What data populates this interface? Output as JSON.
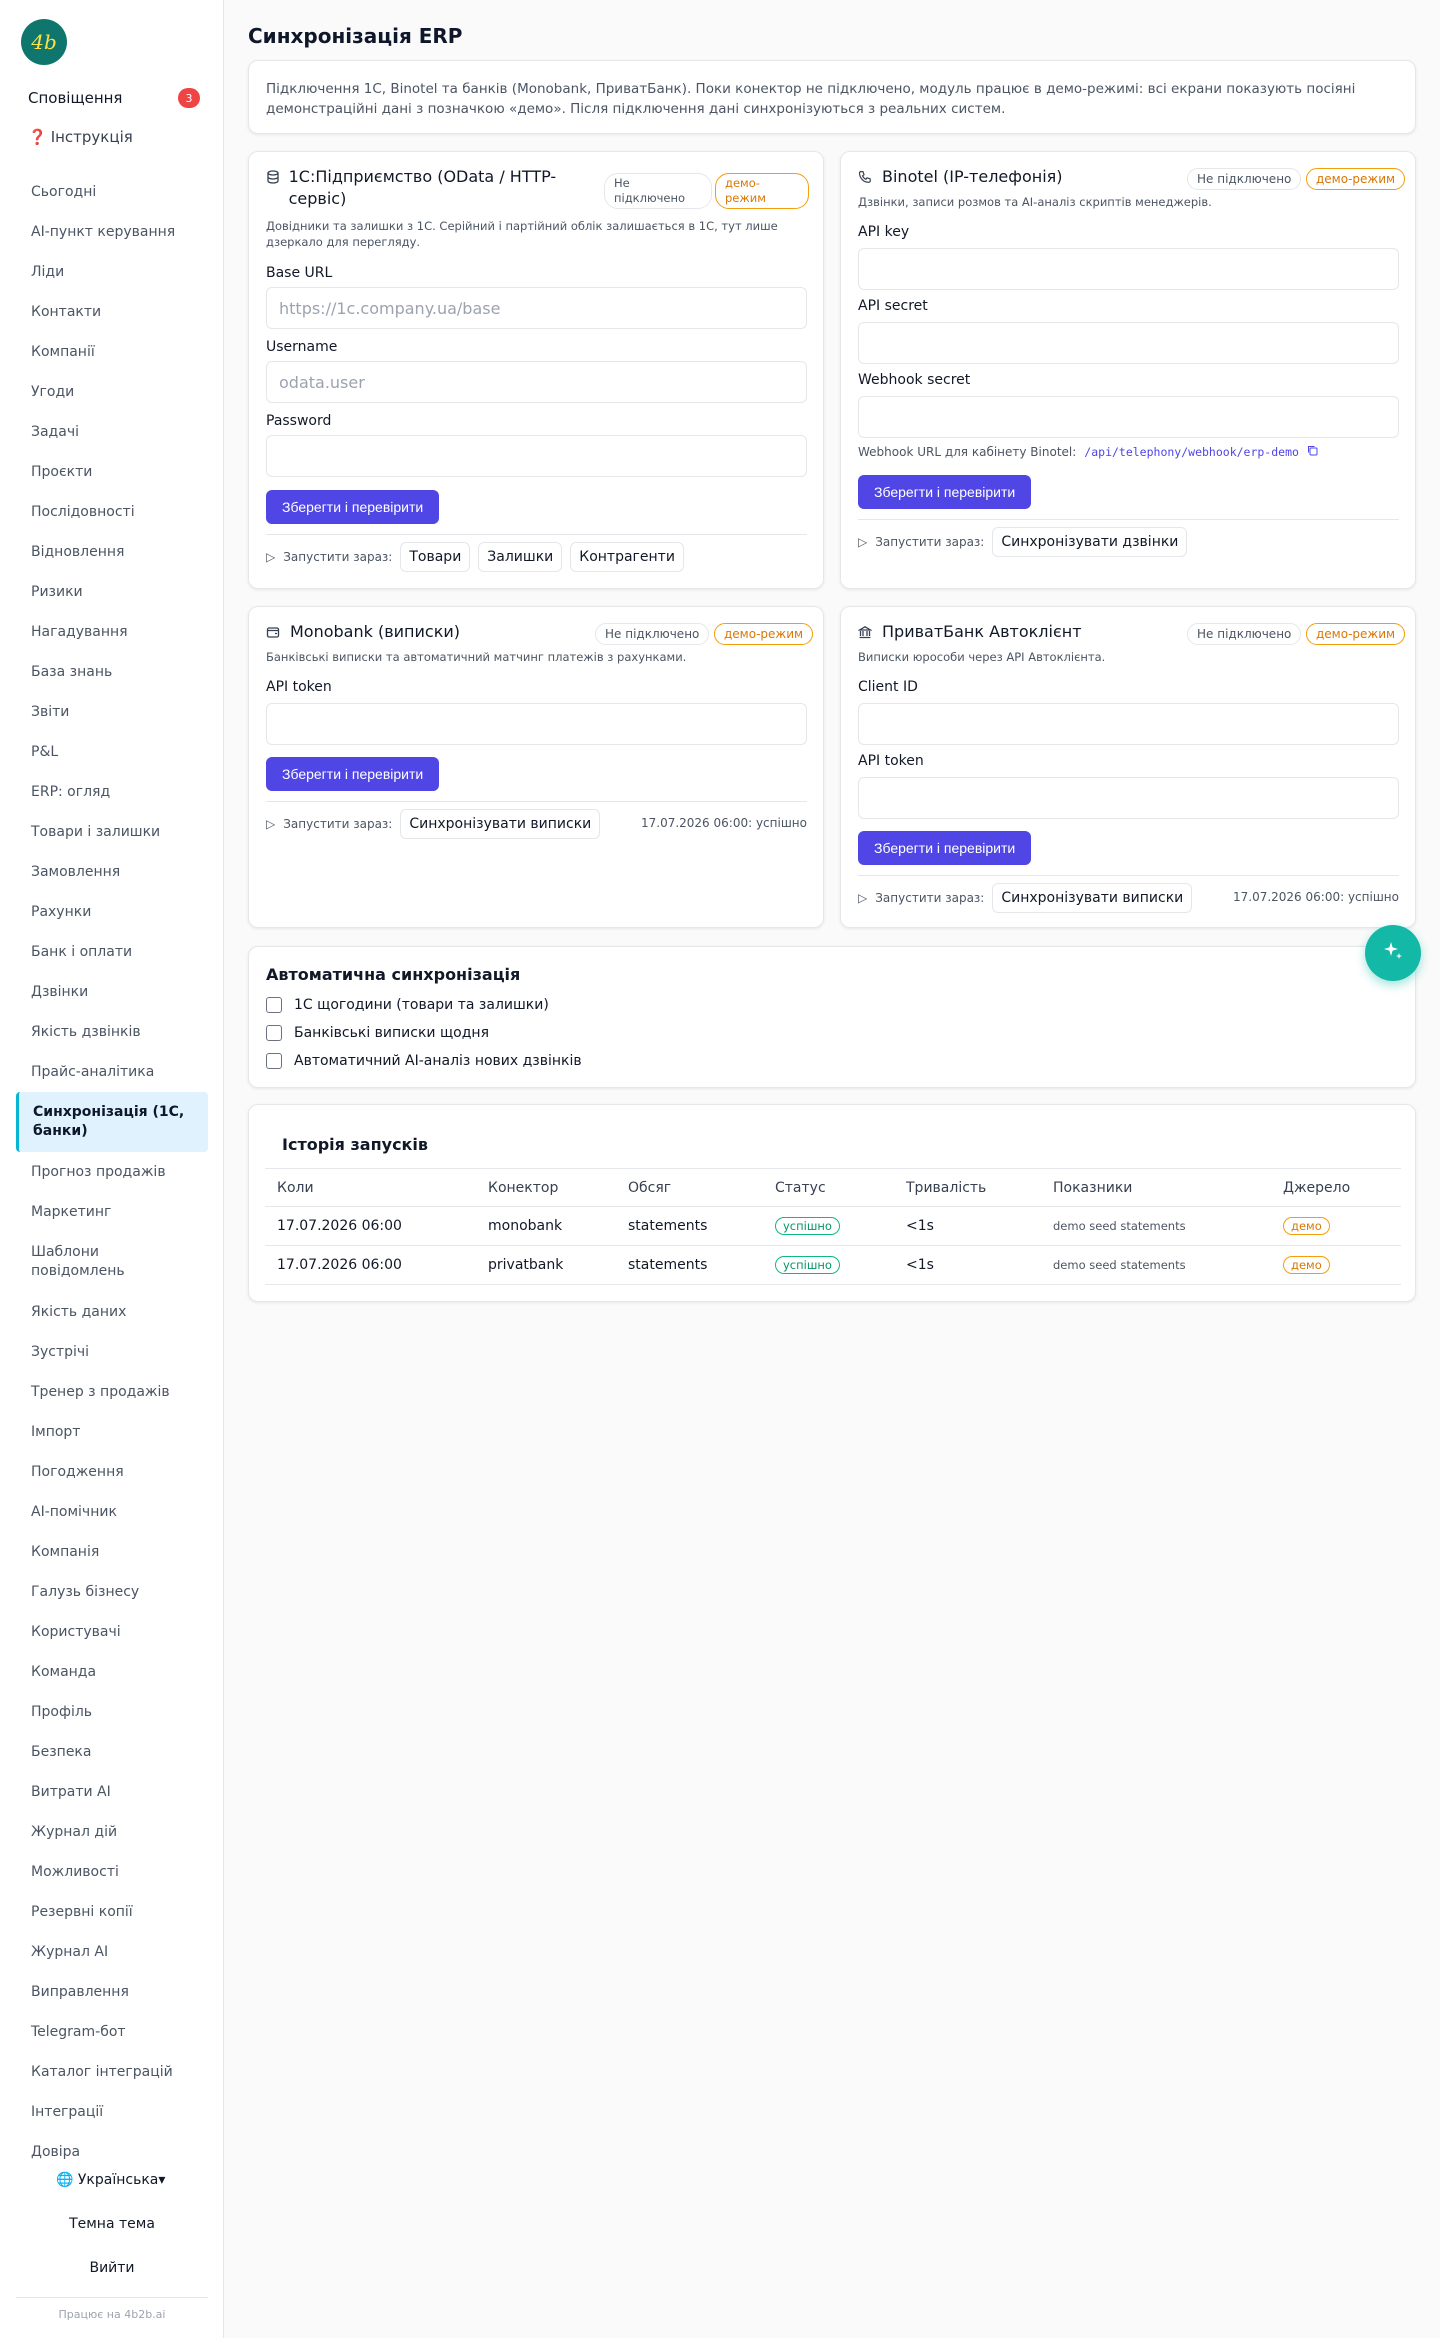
{
  "sidebar": {
    "logo_text": "4b",
    "notifications_label": "Сповіщення",
    "notifications_count": "3",
    "help_label": "Інструкція",
    "help_icon": "❓",
    "items": [
      "Сьогодні",
      "AI-пункт керування",
      "Ліди",
      "Контакти",
      "Компанії",
      "Угоди",
      "Задачі",
      "Проєкти",
      "Послідовності",
      "Відновлення",
      "Ризики",
      "Нагадування",
      "База знань",
      "Звіти",
      "P&L",
      "ERP: огляд",
      "Товари і залишки",
      "Замовлення",
      "Рахунки",
      "Банк і оплати",
      "Дзвінки",
      "Якість дзвінків",
      "Прайс-аналітика",
      "Синхронізація (1С, банки)",
      "Прогноз продажів",
      "Маркетинг",
      "Шаблони повідомлень",
      "Якість даних",
      "Зустрічі",
      "Тренер з продажів",
      "Імпорт",
      "Погодження",
      "AI-помічник",
      "Компанія",
      "Галузь бізнесу",
      "Користувачі",
      "Команда",
      "Профіль",
      "Безпека",
      "Витрати AI",
      "Журнал дій",
      "Можливості",
      "Резервні копії",
      "Журнал AI",
      "Виправлення",
      "Telegram-бот",
      "Каталог інтеграцій",
      "Інтеграції",
      "Довіра"
    ],
    "active_item": "Синхронізація (1С, банки)",
    "language": "🌐 Українська▾",
    "theme_label": "Темна тема",
    "logout_label": "Вийти",
    "powered_by": "Працює на 4b2b.ai"
  },
  "page": {
    "title": "Синхронізація ERP",
    "intro": "Підключення 1С, Binotel та банків (Monobank, ПриватБанк). Поки конектор не підключено, модуль працює в демо-режимі: всі екрани показують посіяні демонстраційні дані з позначкою «демо». Після підключення дані синхронізуються з реальних систем."
  },
  "status": {
    "not_connected": "Не підключено",
    "demo": "демо-режим",
    "not_connected_wrap": "Не\nпідключено",
    "demo_wrap": "демо-\nрежим"
  },
  "common": {
    "save_button": "Зберегти і перевірити",
    "run_now": "Запустити зараз:",
    "sync_calls": "Синхронізувати дзвінки",
    "sync_statements": "Синхронізувати виписки",
    "last_run": "17.07.2026 06:00: успішно"
  },
  "onec": {
    "title": "1С:Підприємство (OData / HTTP-сервіс)",
    "desc": "Довідники та залишки з 1С. Серійний і партійний облік залишається в 1С, тут лише дзеркало для перегляду.",
    "base_url_label": "Base URL",
    "base_url_placeholder": "https://1c.company.ua/base",
    "username_label": "Username",
    "username_placeholder": "odata.user",
    "password_label": "Password",
    "run_products": "Товари",
    "run_stock": "Залишки",
    "run_counterparties": "Контрагенти"
  },
  "binotel": {
    "title": "Binotel (IP-телефонія)",
    "desc": "Дзвінки, записи розмов та AI-аналіз скриптів менеджерів.",
    "api_key_label": "API key",
    "api_secret_label": "API secret",
    "webhook_secret_label": "Webhook secret",
    "webhook_url_label": "Webhook URL для кабінету Binotel:",
    "webhook_url": "/api/telephony/webhook/erp-demo"
  },
  "monobank": {
    "title": "Monobank (виписки)",
    "desc": "Банківські виписки та автоматичний матчинг платежів з рахунками.",
    "api_token_label": "API token"
  },
  "privat": {
    "title": "ПриватБанк Автоклієнт",
    "desc": "Виписки юрособи через API Автоклієнта.",
    "client_id_label": "Client ID",
    "api_token_label": "API token"
  },
  "auto": {
    "title": "Автоматична синхронізація",
    "options": [
      "1С щогодини (товари та залишки)",
      "Банківські виписки щодня",
      "Автоматичний AI-аналіз нових дзвінків"
    ]
  },
  "history": {
    "title": "Історія запусків",
    "columns": [
      "Коли",
      "Конектор",
      "Обсяг",
      "Статус",
      "Тривалість",
      "Показники",
      "Джерело"
    ],
    "rows": [
      [
        "17.07.2026 06:00",
        "monobank",
        "statements",
        "успішно",
        "<1s",
        "demo seed statements",
        "демо"
      ],
      [
        "17.07.2026 06:00",
        "privatbank",
        "statements",
        "успішно",
        "<1s",
        "demo seed statements",
        "демо"
      ]
    ]
  },
  "colors": {
    "accent": "#4f46e5",
    "teal": "#14b8a6",
    "demo": "#f59e0b",
    "success": "#10b981"
  }
}
